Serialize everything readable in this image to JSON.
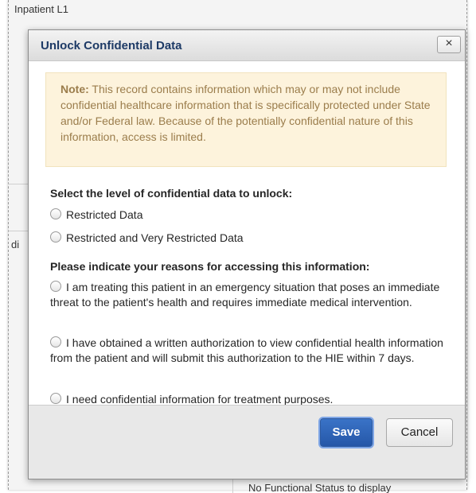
{
  "background": {
    "top_text": "Inpatient  L1",
    "side_text": "di",
    "bottom_text": "No Functional Status to display"
  },
  "dialog": {
    "title": "Unlock Confidential Data",
    "close_label": "×",
    "note": {
      "label": "Note:",
      "text": " This record contains information which may or may not include confidential healthcare information that is specifically protected under State and/or Federal law. Because of the potentially confidential nature of this information, access is limited."
    },
    "level_heading": "Select the level of confidential data to unlock:",
    "levels": [
      "Restricted Data",
      "Restricted and Very Restricted Data"
    ],
    "reason_heading": "Please indicate your reasons for accessing this information:",
    "reasons": [
      "I am treating this patient in an emergency situation that poses an immediate threat to the patient's health and requires immediate medical intervention.",
      "I have obtained a written authorization to view confidential health information from the patient and will submit this authorization to the HIE within 7 days.",
      "I need confidential information for treatment purposes."
    ],
    "save_label": "Save",
    "cancel_label": "Cancel"
  },
  "colors": {
    "title_text": "#1d3a66",
    "note_background": "#fdf3dc",
    "note_text": "#9b7d4c",
    "save_button": "#2557a8"
  }
}
